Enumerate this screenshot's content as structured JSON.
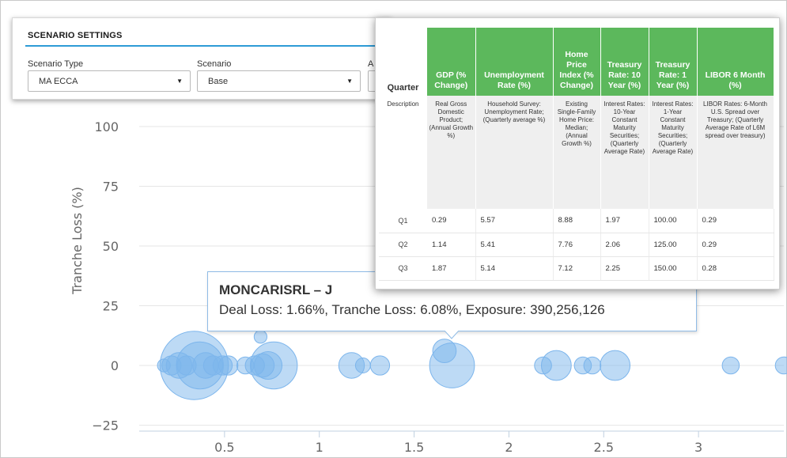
{
  "chart_data": {
    "type": "scatter",
    "variant": "bubble",
    "ylabel": "Tranche Loss (%)",
    "xlabel": "",
    "xlim": [
      0.05,
      3.45
    ],
    "ylim": [
      -25,
      100
    ],
    "xticks": [
      "0.5",
      "1",
      "1.5",
      "2",
      "2.5",
      "3"
    ],
    "xtick_values": [
      0.5,
      1,
      1.5,
      2,
      2.5,
      3
    ],
    "yticks": [
      "100",
      "75",
      "50",
      "25",
      "0",
      "−25"
    ],
    "ytick_values": [
      100,
      75,
      50,
      25,
      0,
      -25
    ],
    "grid": true,
    "bubble_color": "#7cb5ec",
    "points": [
      {
        "x": 0.18,
        "y": 0,
        "size": 6
      },
      {
        "x": 0.22,
        "y": 0,
        "size": 9
      },
      {
        "x": 0.26,
        "y": 0,
        "size": 12
      },
      {
        "x": 0.3,
        "y": 0,
        "size": 9
      },
      {
        "x": 0.34,
        "y": 0,
        "size": 32
      },
      {
        "x": 0.37,
        "y": 0,
        "size": 22
      },
      {
        "x": 0.4,
        "y": 0,
        "size": 12
      },
      {
        "x": 0.44,
        "y": 0,
        "size": 9
      },
      {
        "x": 0.49,
        "y": 0,
        "size": 9
      },
      {
        "x": 0.52,
        "y": 0,
        "size": 9
      },
      {
        "x": 0.61,
        "y": 0,
        "size": 8
      },
      {
        "x": 0.69,
        "y": 12,
        "size": 6
      },
      {
        "x": 0.66,
        "y": 0,
        "size": 9
      },
      {
        "x": 0.7,
        "y": 0,
        "size": 11
      },
      {
        "x": 0.73,
        "y": 0,
        "size": 13
      },
      {
        "x": 0.76,
        "y": 0,
        "size": 22
      },
      {
        "x": 1.17,
        "y": 0,
        "size": 12
      },
      {
        "x": 1.23,
        "y": 0,
        "size": 7
      },
      {
        "x": 1.32,
        "y": 0,
        "size": 9
      },
      {
        "x": 1.66,
        "y": 6.08,
        "size": 11
      },
      {
        "x": 1.7,
        "y": 0,
        "size": 21
      },
      {
        "x": 2.18,
        "y": 0,
        "size": 8
      },
      {
        "x": 2.25,
        "y": 0,
        "size": 14
      },
      {
        "x": 2.39,
        "y": 0,
        "size": 8
      },
      {
        "x": 2.44,
        "y": 0,
        "size": 8
      },
      {
        "x": 2.56,
        "y": 0,
        "size": 14
      },
      {
        "x": 3.17,
        "y": 0,
        "size": 8
      },
      {
        "x": 3.45,
        "y": 0,
        "size": 8
      }
    ]
  },
  "scenario": {
    "title": "SCENARIO SETTINGS",
    "type_label": "Scenario Type",
    "type_value": "MA ECCA",
    "scenario_label": "Scenario",
    "scenario_value": "Base",
    "third_label_partial": "A"
  },
  "econ_table": {
    "quarter_header": "Quarter",
    "columns": [
      "GDP (% Change)",
      "Unemployment Rate (%)",
      "Home Price Index (% Change)",
      "Treasury Rate: 10 Year (%)",
      "Treasury Rate: 1 Year (%)",
      "LIBOR 6 Month (%)"
    ],
    "description_label": "Description",
    "descriptions": [
      "Real Gross Domestic Product; (Annual Growth %)",
      "Household Survey: Unemployment Rate; (Quarterly average %)",
      "Existing Single-Family Home Price: Median; (Annual Growth %)",
      "Interest Rates: 10-Year Constant Maturity Securities; (Quarterly Average Rate)",
      "Interest Rates: 1-Year Constant Maturity Securities; (Quarterly Average Rate)",
      "LIBOR Rates: 6-Month U.S. Spread over Treasury; (Quarterly Average Rate of L6M spread over treasury)"
    ],
    "rows": [
      {
        "quarter": "Q1",
        "values": [
          "0.29",
          "5.57",
          "8.88",
          "1.97",
          "100.00",
          "0.29"
        ]
      },
      {
        "quarter": "Q2",
        "values": [
          "1.14",
          "5.41",
          "7.76",
          "2.06",
          "125.00",
          "0.29"
        ]
      },
      {
        "quarter": "Q3",
        "values": [
          "1.87",
          "5.14",
          "7.12",
          "2.25",
          "150.00",
          "0.28"
        ]
      }
    ]
  },
  "tooltip": {
    "title": "MONCARISRL – J",
    "body": "Deal Loss: 1.66%, Tranche Loss: 6.08%, Exposure: 390,256,126"
  },
  "colors": {
    "accent": "#2d9bd6",
    "table_header": "#5cb85c",
    "bubble": "#7cb5ec"
  }
}
